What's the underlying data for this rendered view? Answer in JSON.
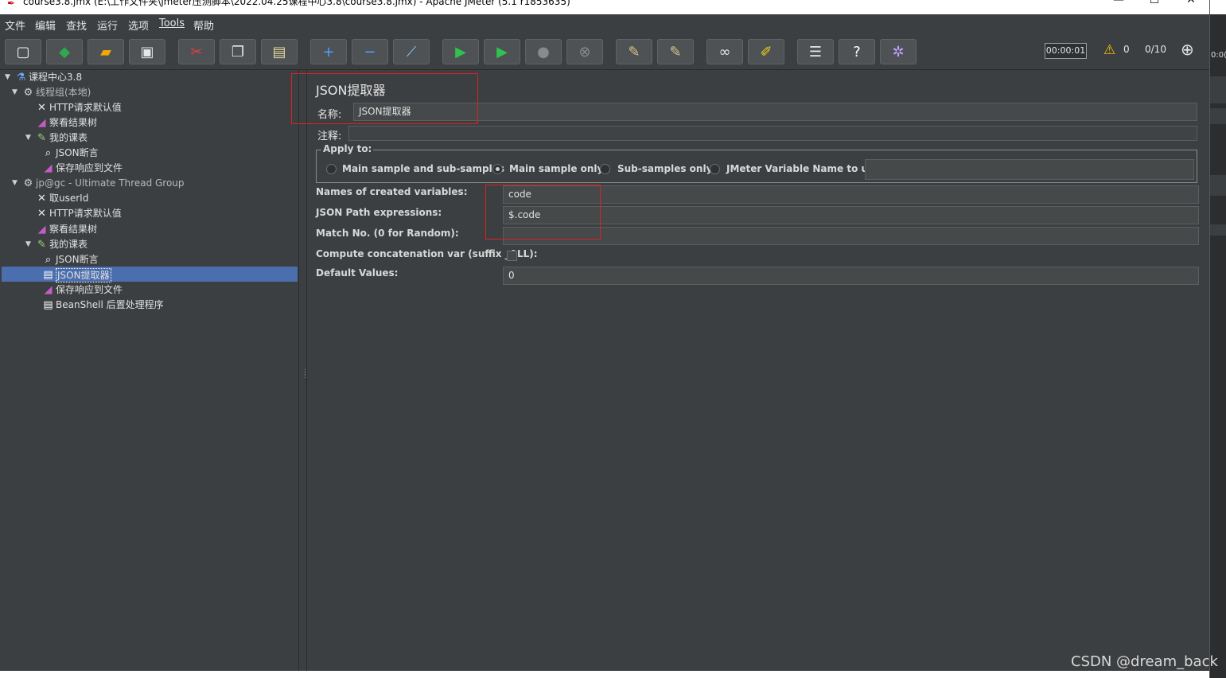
{
  "window": {
    "title": "course3.8.jmx (E:\\工作文件夹\\jmeter压测脚本\\2022.04.25课程中心3.8\\course3.8.jmx) - Apache JMeter (5.1 r1853635)",
    "minimize": "—",
    "maximize": "☐",
    "close": "✕",
    "right_strip_text": "0:0("
  },
  "menu": [
    "文件",
    "编辑",
    "查找",
    "运行",
    "选项",
    "Tools",
    "帮助"
  ],
  "toolbar": {
    "buttons": [
      {
        "name": "new-button",
        "icon": "new-file-icon",
        "glyph": "▢",
        "color": "#f2f2f2"
      },
      {
        "name": "templates-button",
        "icon": "templates-icon",
        "glyph": "◆",
        "color": "#2fa84f"
      },
      {
        "name": "open-button",
        "icon": "folder-icon",
        "glyph": "▰",
        "color": "#f0a800"
      },
      {
        "name": "save-button",
        "icon": "save-icon",
        "glyph": "▣",
        "color": "#e6e6e6"
      },
      {
        "name": "cut-button",
        "icon": "scissors-icon",
        "glyph": "✂",
        "color": "#e04040"
      },
      {
        "name": "copy-button",
        "icon": "copy-icon",
        "glyph": "❐",
        "color": "#e6e6e6"
      },
      {
        "name": "paste-button",
        "icon": "clipboard-icon",
        "glyph": "▤",
        "color": "#e6d9a0"
      },
      {
        "name": "expand-button",
        "icon": "plus-icon",
        "glyph": "+",
        "color": "#4aa3ff"
      },
      {
        "name": "collapse-button",
        "icon": "minus-icon",
        "glyph": "−",
        "color": "#4aa3ff"
      },
      {
        "name": "toggle-button",
        "icon": "toggle-icon",
        "glyph": "⟋",
        "color": "#8fc8ff"
      },
      {
        "name": "start-button",
        "icon": "play-icon",
        "glyph": "▶",
        "color": "#2fc24f"
      },
      {
        "name": "start-no-pause-button",
        "icon": "play-no-timer-icon",
        "glyph": "▶",
        "color": "#2fc24f"
      },
      {
        "name": "stop-button",
        "icon": "stop-icon",
        "glyph": "●",
        "color": "#8a8a8a"
      },
      {
        "name": "shutdown-button",
        "icon": "shutdown-icon",
        "glyph": "⊗",
        "color": "#8a8a8a"
      },
      {
        "name": "clear-button",
        "icon": "broom-icon",
        "glyph": "✎",
        "color": "#d9c28a"
      },
      {
        "name": "clear-all-button",
        "icon": "broom-all-icon",
        "glyph": "✎",
        "color": "#d9c28a"
      },
      {
        "name": "search-button",
        "icon": "binoculars-icon",
        "glyph": "∞",
        "color": "#e6e6e6"
      },
      {
        "name": "reset-search-button",
        "icon": "eraser-icon",
        "glyph": "✐",
        "color": "#f2d21a"
      },
      {
        "name": "function-helper-button",
        "icon": "list-icon",
        "glyph": "☰",
        "color": "#e6e6e6"
      },
      {
        "name": "help-button",
        "icon": "help-icon",
        "glyph": "?",
        "color": "#ffffff"
      },
      {
        "name": "remote-button",
        "icon": "remote-icon",
        "glyph": "✲",
        "color": "#c0a0ff"
      }
    ],
    "timer": "00:00:01",
    "warning_count": "0",
    "threads": "0/10",
    "warning_icon": "warning-icon",
    "remote_status_icon": "globe-icon"
  },
  "tree": {
    "nodes": [
      {
        "label": "课程中心3.8",
        "icon": "test-plan-icon",
        "glyph": "⚗",
        "color": "#6aa8ff",
        "toggle": "▼",
        "level": 0
      },
      {
        "label": "线程组(本地)",
        "icon": "thread-group-gear-icon",
        "glyph": "⚙",
        "color": "#d0d0d0",
        "toggle": "▼",
        "level": 1,
        "dim": true
      },
      {
        "label": "HTTP请求默认值",
        "icon": "config-tools-icon",
        "glyph": "✕",
        "color": "#e6e6e6",
        "toggle": "",
        "level": 2
      },
      {
        "label": "察看结果树",
        "icon": "listener-icon",
        "glyph": "◢",
        "color": "#c85ac8",
        "toggle": "",
        "level": 2
      },
      {
        "label": "我的课表",
        "icon": "sampler-pen-icon",
        "glyph": "✎",
        "color": "#9ad07a",
        "toggle": "▼",
        "level": 2
      },
      {
        "label": "JSON断言",
        "icon": "assertion-magnifier-icon",
        "glyph": "⌕",
        "color": "#ffffff",
        "toggle": "",
        "level": 3
      },
      {
        "label": "保存响应到文件",
        "icon": "listener-icon",
        "glyph": "◢",
        "color": "#c85ac8",
        "toggle": "",
        "level": 3
      },
      {
        "label": "jp@gc - Ultimate Thread Group",
        "icon": "thread-group-gear-icon",
        "glyph": "⚙",
        "color": "#d0d0d0",
        "toggle": "▼",
        "level": 1,
        "dim": true
      },
      {
        "label": "取userId",
        "icon": "config-tools-icon",
        "glyph": "✕",
        "color": "#e6e6e6",
        "toggle": "",
        "level": 2
      },
      {
        "label": "HTTP请求默认值",
        "icon": "config-tools-icon",
        "glyph": "✕",
        "color": "#e6e6e6",
        "toggle": "",
        "level": 2
      },
      {
        "label": "察看结果树",
        "icon": "listener-icon",
        "glyph": "◢",
        "color": "#c85ac8",
        "toggle": "",
        "level": 2
      },
      {
        "label": "我的课表",
        "icon": "sampler-pen-icon",
        "glyph": "✎",
        "color": "#9ad07a",
        "toggle": "▼",
        "level": 2
      },
      {
        "label": "JSON断言",
        "icon": "assertion-magnifier-icon",
        "glyph": "⌕",
        "color": "#ffffff",
        "toggle": "",
        "level": 3
      },
      {
        "label": "JSON提取器",
        "icon": "post-processor-doc-icon",
        "glyph": "▤",
        "color": "#ffffff",
        "toggle": "",
        "level": 3,
        "selected": true
      },
      {
        "label": "保存响应到文件",
        "icon": "listener-icon",
        "glyph": "◢",
        "color": "#c85ac8",
        "toggle": "",
        "level": 3
      },
      {
        "label": "BeanShell 后置处理程序",
        "icon": "post-processor-doc-icon",
        "glyph": "▤",
        "color": "#ffffff",
        "toggle": "",
        "level": 3
      }
    ]
  },
  "editor": {
    "title": "JSON提取器",
    "name_label": "名称:",
    "name_value": "JSON提取器",
    "comment_label": "注释:",
    "comment_value": "",
    "apply_to": {
      "title": "Apply to:",
      "options": [
        "Main sample and sub-samples",
        "Main sample only",
        "Sub-samples only",
        "JMeter Variable Name to use"
      ],
      "selected": "Main sample only",
      "variable_name_value": ""
    },
    "fields": [
      {
        "label": "Names of created variables:",
        "value": "code"
      },
      {
        "label": "JSON Path expressions:",
        "value": "$.code"
      },
      {
        "label": "Match No. (0 for Random):",
        "value": ""
      },
      {
        "label": "Compute concatenation var (suffix _ALL):",
        "value": ""
      },
      {
        "label": "Default Values:",
        "value": "0"
      }
    ],
    "highlight_color": "#e02020"
  },
  "watermark": "CSDN @dream_back"
}
